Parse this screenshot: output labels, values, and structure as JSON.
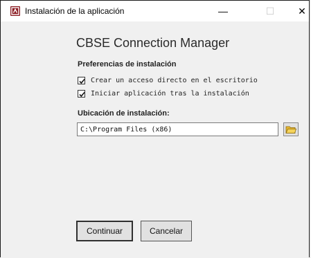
{
  "window": {
    "title": "Instalación de la aplicación",
    "controls": {
      "minimize": "—",
      "maximize": "☐",
      "close": "✕"
    }
  },
  "main": {
    "app_name": "CBSE Connection Manager",
    "preferences": {
      "label": "Preferencias de instalación",
      "options": [
        {
          "label": "Crear un acceso directo en el escritorio",
          "checked": true
        },
        {
          "label": "Iniciar aplicación tras la instalación",
          "checked": true
        }
      ]
    },
    "location": {
      "label": "Ubicación de instalación:",
      "value": "C:\\Program Files (x86)",
      "browse_icon": "folder-open-icon"
    }
  },
  "footer": {
    "continue_label": "Continuar",
    "cancel_label": "Cancelar"
  },
  "colors": {
    "app_icon": "#8b1c22",
    "folder": "#e8b830"
  }
}
